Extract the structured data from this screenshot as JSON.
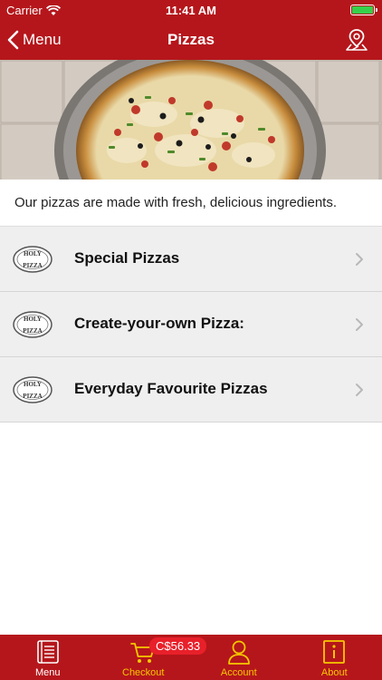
{
  "status_bar": {
    "carrier": "Carrier",
    "time": "11:41 AM"
  },
  "nav": {
    "back_label": "Menu",
    "title": "Pizzas",
    "right_icon": "map-pin-icon"
  },
  "intro_text": "Our pizzas are made with fresh, delicious ingredients.",
  "categories": [
    {
      "label": "Special Pizzas"
    },
    {
      "label": "Create-your-own Pizza:"
    },
    {
      "label": "Everyday Favourite Pizzas"
    }
  ],
  "tabbar": {
    "menu": "Menu",
    "checkout": "Checkout",
    "account": "Account",
    "about": "About",
    "cart_total": "C$56.33"
  },
  "logo_text": {
    "top": "HOLY",
    "bottom": "PIZZA"
  },
  "colors": {
    "brand_red": "#b5161b",
    "tab_accent": "#f5c800",
    "badge": "#e8202a"
  }
}
